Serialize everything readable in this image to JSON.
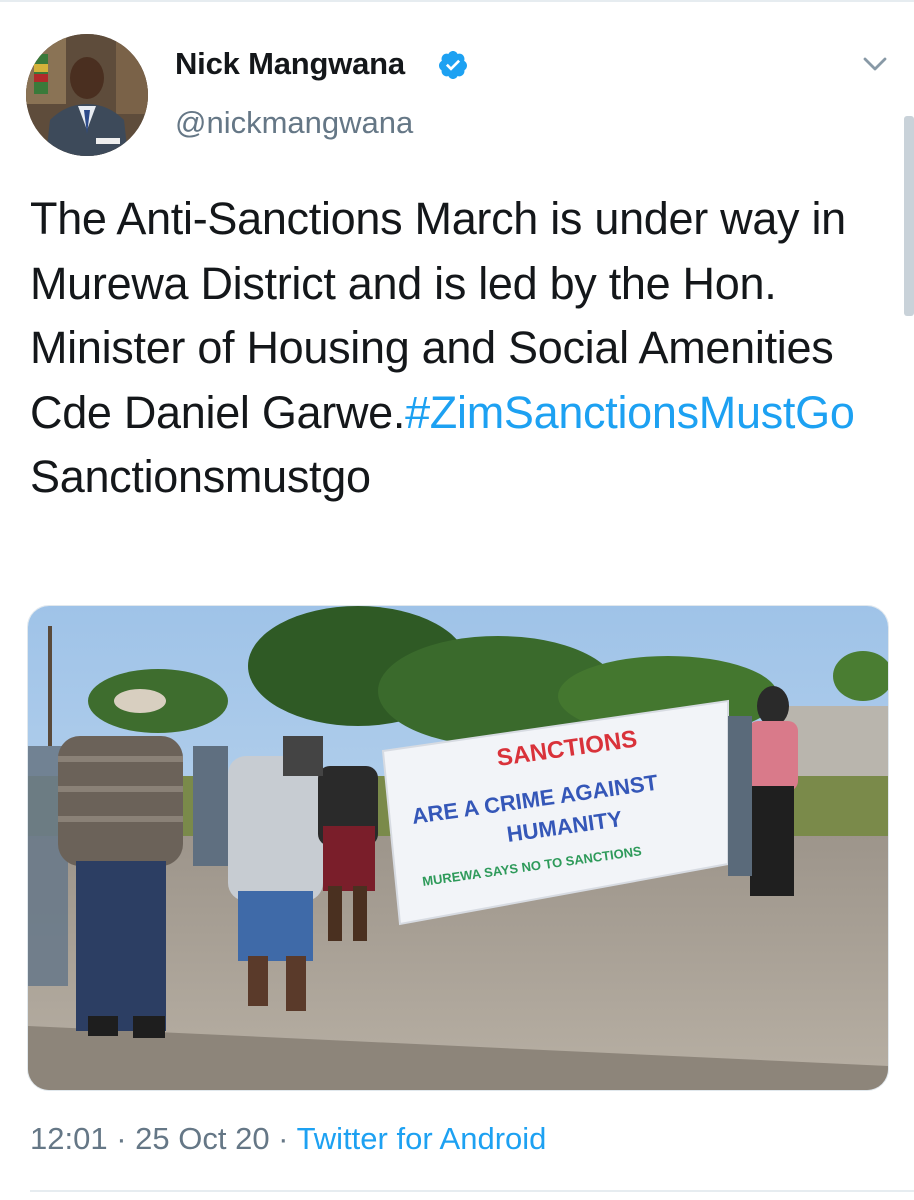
{
  "author": {
    "name": "Nick Mangwana",
    "handle": "@nickmangwana",
    "verified": true,
    "avatar_icon": "profile-photo"
  },
  "tweet": {
    "text_parts": [
      "The Anti-Sanctions March is under way in Murewa District and is led by the Hon. Minister of Housing and Social Amenities Cde Daniel Garwe.",
      "#ZimSanctionsMustGo",
      " Sanctionsmustgo"
    ]
  },
  "media": {
    "banner_lines": {
      "line1": "SANCTIONS",
      "line2": "ARE A CRIME AGAINST",
      "line3": "HUMANITY",
      "line4": "MUREWA SAYS NO TO SANCTIONS"
    }
  },
  "meta": {
    "time": "12:01",
    "separator1": " · ",
    "date": "25 Oct 20",
    "separator2": " · ",
    "source": "Twitter for Android"
  },
  "colors": {
    "link": "#1da1f2",
    "secondary_text": "#657786",
    "verified_badge": "#1da1f2"
  },
  "icons": {
    "verified": "verified-badge-icon",
    "more": "chevron-down-icon"
  }
}
